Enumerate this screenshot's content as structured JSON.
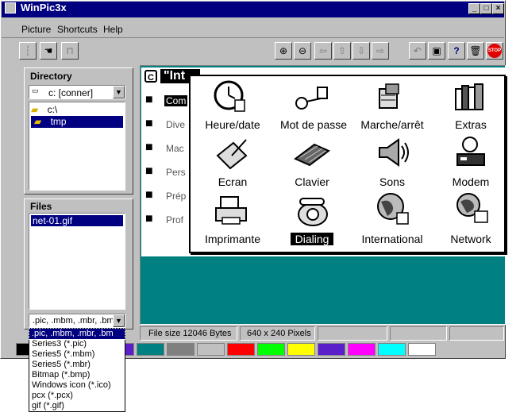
{
  "window": {
    "title": "WinPic3x"
  },
  "menu": [
    "Picture",
    "Shortcuts",
    "Help"
  ],
  "directory": {
    "label": "Directory",
    "drive": "c: [conner]",
    "folders": [
      "c:\\",
      "tmp"
    ]
  },
  "files": {
    "label": "Files",
    "items": [
      "net-01.gif"
    ]
  },
  "filetype": {
    "value": ".pic, .mbm, .mbr, .bm",
    "options": [
      ".pic, .mbm, .mbr, .bm",
      "Series3 (*.pic)",
      "Series5 (*.mbm)",
      "Series5 (*.mbr)",
      "Bitmap (*.bmp)",
      "Windows icon (*.ico)",
      "pcx (*.pcx)",
      "gif (*.gif)"
    ]
  },
  "preview": {
    "header": "\"Int",
    "header_icon_letter": "C",
    "folder_items": [
      "Com",
      "Dive",
      "Mac",
      "Pers",
      "Prép",
      "Prof"
    ]
  },
  "control_panel": {
    "items": [
      {
        "label": "Heure/date",
        "icon": "clock-icon"
      },
      {
        "label": "Mot de passe",
        "icon": "keys-icon"
      },
      {
        "label": "Marche/arrêt",
        "icon": "power-icon"
      },
      {
        "label": "Extras",
        "icon": "books-icon"
      },
      {
        "label": "Ecran",
        "icon": "screen-icon"
      },
      {
        "label": "Clavier",
        "icon": "keyboard-icon"
      },
      {
        "label": "Sons",
        "icon": "speaker-icon"
      },
      {
        "label": "Modem",
        "icon": "modem-icon"
      },
      {
        "label": "Imprimante",
        "icon": "printer-icon"
      },
      {
        "label": "Dialing",
        "icon": "phone-icon"
      },
      {
        "label": "International",
        "icon": "globe-icon"
      },
      {
        "label": "Network",
        "icon": "network-icon"
      }
    ],
    "selected": "Dialing"
  },
  "status": {
    "file_size": "File size  12046 Bytes",
    "dimensions": "640 x 240 Pixels"
  },
  "palette": [
    "#000000",
    "#ffffff",
    "#000080",
    "#5a1fc8",
    "#008080",
    "#808080",
    "#c0c0c0",
    "#ff0000",
    "#00ff00",
    "#ffff00",
    "#5a1fc8",
    "#ff00ff",
    "#00ffff",
    "#ffffff"
  ],
  "colors": {
    "titlebar": "#000080",
    "preview_bg": "#008080",
    "selection": "#000080"
  }
}
